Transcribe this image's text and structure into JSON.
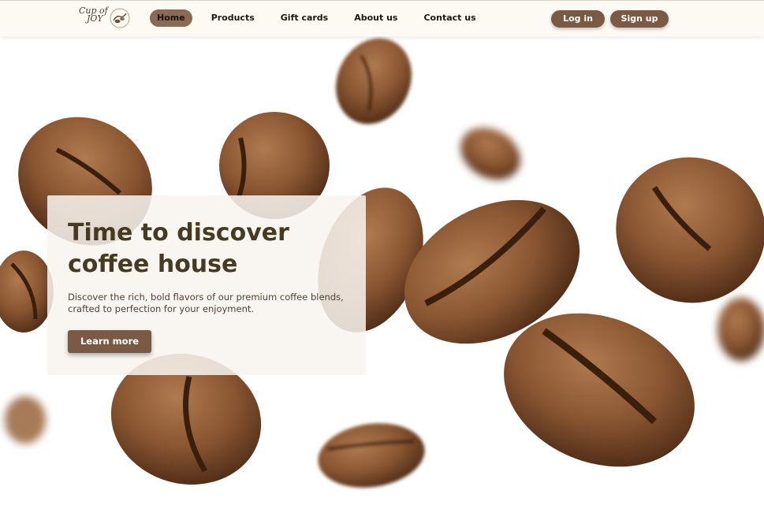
{
  "brand": {
    "logo_line1": "Cup of",
    "logo_line2": "JOY"
  },
  "nav": {
    "items": [
      {
        "label": "Home",
        "active": true
      },
      {
        "label": "Products",
        "active": false
      },
      {
        "label": "Gift cards",
        "active": false
      },
      {
        "label": "About us",
        "active": false
      },
      {
        "label": "Contact us",
        "active": false
      }
    ]
  },
  "auth": {
    "login_label": "Log in",
    "signup_label": "Sign up"
  },
  "hero": {
    "title": "Time to discover coffee house",
    "description": "Discover the rich, bold flavors of our premium coffee blends, crafted to perfection for your enjoyment.",
    "cta_label": "Learn more",
    "background_image": "coffee-beans-image"
  },
  "colors": {
    "accent": "#7a5a44",
    "header_bg": "#fdf9f3",
    "title": "#473a22"
  }
}
